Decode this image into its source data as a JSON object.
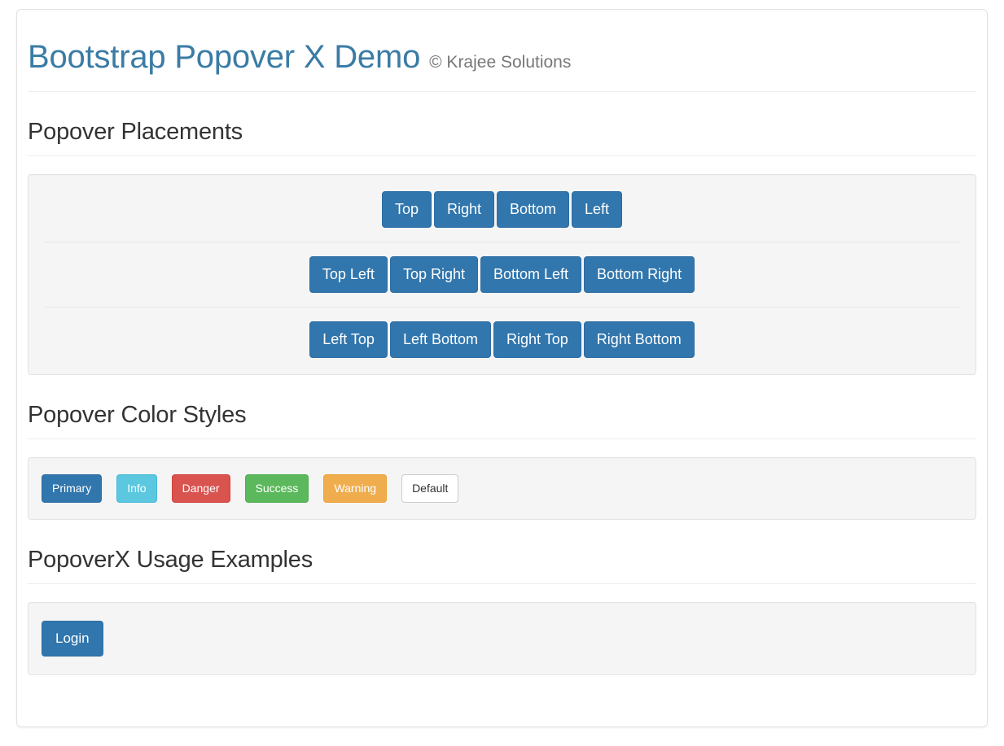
{
  "header": {
    "title": "Bootstrap Popover X Demo",
    "subtitle": "© Krajee Solutions"
  },
  "sections": {
    "placements": {
      "heading": "Popover Placements",
      "rows": [
        {
          "buttons": [
            {
              "label": "Top",
              "style": "primary"
            },
            {
              "label": "Right",
              "style": "primary"
            },
            {
              "label": "Bottom",
              "style": "primary"
            },
            {
              "label": "Left",
              "style": "primary"
            }
          ]
        },
        {
          "buttons": [
            {
              "label": "Top Left",
              "style": "primary"
            },
            {
              "label": "Top Right",
              "style": "primary"
            },
            {
              "label": "Bottom Left",
              "style": "primary"
            },
            {
              "label": "Bottom Right",
              "style": "primary"
            }
          ]
        },
        {
          "buttons": [
            {
              "label": "Left Top",
              "style": "primary"
            },
            {
              "label": "Left Bottom",
              "style": "primary"
            },
            {
              "label": "Right Top",
              "style": "primary"
            },
            {
              "label": "Right Bottom",
              "style": "primary"
            }
          ]
        }
      ]
    },
    "colors": {
      "heading": "Popover Color Styles",
      "buttons": [
        {
          "label": "Primary",
          "style": "primary",
          "color": "#3176ad"
        },
        {
          "label": "Info",
          "style": "info",
          "color": "#5bc8e0"
        },
        {
          "label": "Danger",
          "style": "danger",
          "color": "#d9534f"
        },
        {
          "label": "Success",
          "style": "success",
          "color": "#5cb85c"
        },
        {
          "label": "Warning",
          "style": "warning",
          "color": "#efad4e"
        },
        {
          "label": "Default",
          "style": "default",
          "color": "#ffffff"
        }
      ]
    },
    "usage": {
      "heading": "PopoverX Usage Examples",
      "buttons": [
        {
          "label": "Login",
          "style": "primary"
        }
      ]
    }
  },
  "theme": {
    "title_color": "#3a7ca5",
    "primary": "#3176ad",
    "well_bg": "#f5f5f5",
    "text": "#333333",
    "muted": "#777777"
  }
}
